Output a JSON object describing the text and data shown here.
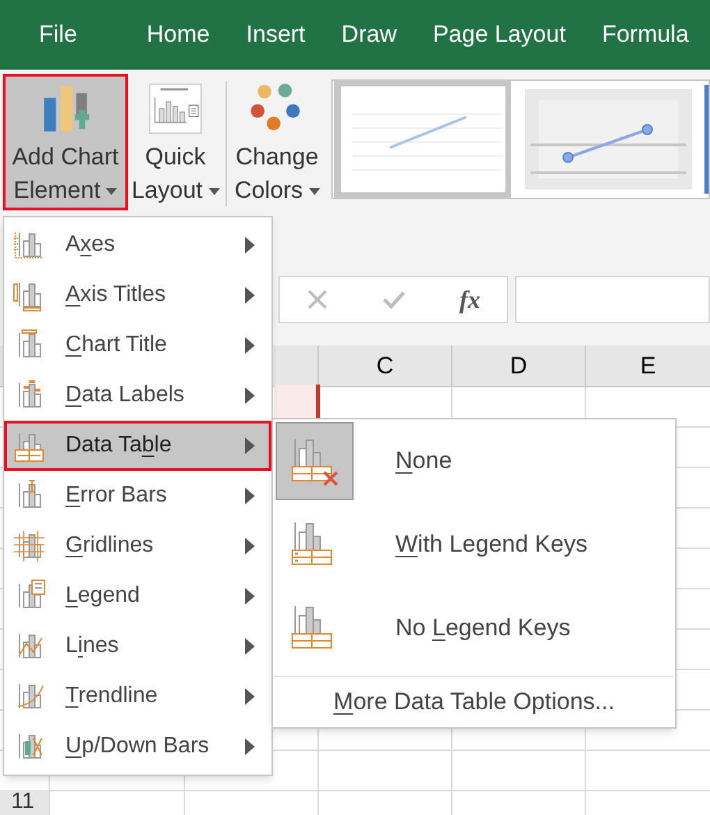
{
  "tabs": [
    {
      "label": "File"
    },
    {
      "label": "Home"
    },
    {
      "label": "Insert"
    },
    {
      "label": "Draw"
    },
    {
      "label": "Page Layout"
    },
    {
      "label": "Formula"
    }
  ],
  "ribbon_buttons": [
    {
      "kind": "add_chart",
      "lines": [
        "Add Chart",
        "Element"
      ],
      "active": true
    },
    {
      "kind": "quick_layout",
      "lines": [
        "Quick",
        "Layout"
      ],
      "active": false
    },
    {
      "kind": "change_colors",
      "lines": [
        "Change",
        "Colors"
      ],
      "active": false
    }
  ],
  "chart_styles": [
    {
      "kind": "plain",
      "selected": true
    },
    {
      "kind": "shaded",
      "selected": false
    }
  ],
  "formula_bar": {
    "function_label": "fx"
  },
  "columns": [
    "C",
    "D",
    "E"
  ],
  "row_numbers": [
    "11"
  ],
  "menu": {
    "items": [
      {
        "pre": "A",
        "key": "x",
        "post": "es",
        "selected": false
      },
      {
        "key": "A",
        "post": "xis Titles",
        "selected": false
      },
      {
        "key": "C",
        "post": "hart Title",
        "selected": false
      },
      {
        "key": "D",
        "post": "ata Labels",
        "selected": false
      },
      {
        "pre": "Data Ta",
        "key": "b",
        "post": "le",
        "selected": true
      },
      {
        "key": "E",
        "post": "rror Bars",
        "selected": false
      },
      {
        "key": "G",
        "post": "ridlines",
        "selected": false
      },
      {
        "key": "L",
        "post": "egend",
        "selected": false
      },
      {
        "pre": "L",
        "key": "i",
        "post": "nes",
        "selected": false
      },
      {
        "key": "T",
        "post": "rendline",
        "selected": false
      },
      {
        "key": "U",
        "post": "p/Down Bars",
        "selected": false
      }
    ]
  },
  "submenu": {
    "items": [
      {
        "kind": "none",
        "key": "N",
        "post": "one",
        "selected": true
      },
      {
        "kind": "legend_keys",
        "key": "W",
        "post": "ith Legend Keys",
        "selected": false
      },
      {
        "kind": "no_legend_keys",
        "pre": "No ",
        "key": "L",
        "post": "egend Keys",
        "selected": false
      }
    ],
    "footer": {
      "key": "M",
      "post": "ore Data Table Options..."
    }
  }
}
